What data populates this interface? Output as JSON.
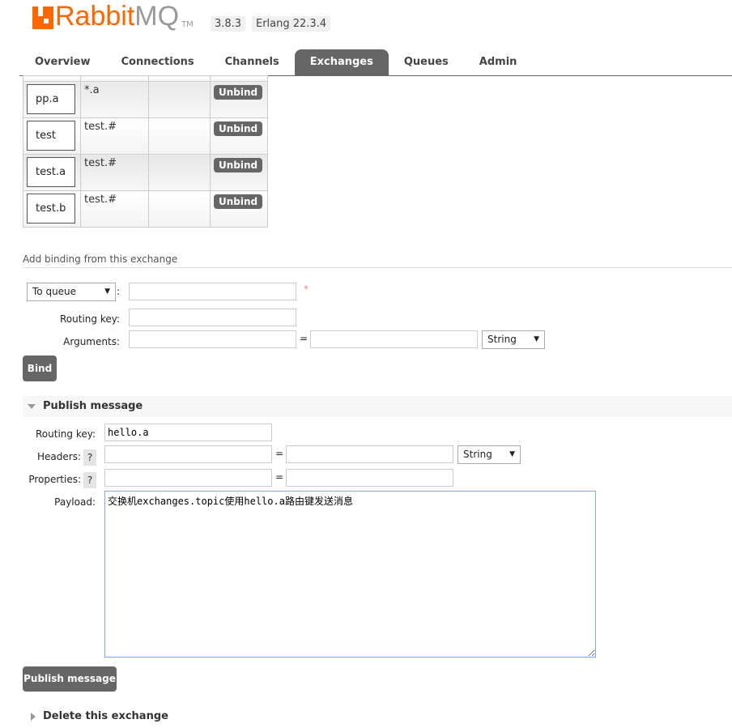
{
  "header": {
    "logo": "RabbitMQ",
    "tm": "TM",
    "version": "3.8.3",
    "erlang": "Erlang 22.3.4"
  },
  "tabs": [
    "Overview",
    "Connections",
    "Channels",
    "Exchanges",
    "Queues",
    "Admin"
  ],
  "active_tab": "Exchanges",
  "bindings": [
    {
      "to": "pp.a",
      "routing_key": "*.a",
      "arguments": "",
      "action": "Unbind"
    },
    {
      "to": "test",
      "routing_key": "test.#",
      "arguments": "",
      "action": "Unbind"
    },
    {
      "to": "test.a",
      "routing_key": "test.#",
      "arguments": "",
      "action": "Unbind"
    },
    {
      "to": "test.b",
      "routing_key": "test.#",
      "arguments": "",
      "action": "Unbind"
    }
  ],
  "add_binding": {
    "title": "Add binding from this exchange",
    "destination_type": "To queue",
    "colon": ":",
    "required": "*",
    "routing_key_label": "Routing key:",
    "arguments_label": "Arguments:",
    "equals": "=",
    "arg_type": "String",
    "bind_label": "Bind"
  },
  "publish": {
    "title": "Publish message",
    "routing_key_label": "Routing key:",
    "routing_key": "hello.a",
    "headers_label": "Headers:",
    "properties_label": "Properties:",
    "help": "?",
    "equals": "=",
    "header_type": "String",
    "payload_label": "Payload:",
    "payload": "交换机exchanges.topic使用hello.a路由键发送消息",
    "button": "Publish message"
  },
  "delete": {
    "title": "Delete this exchange"
  },
  "colors": {
    "brand": "#ff6600",
    "button": "#666666"
  }
}
